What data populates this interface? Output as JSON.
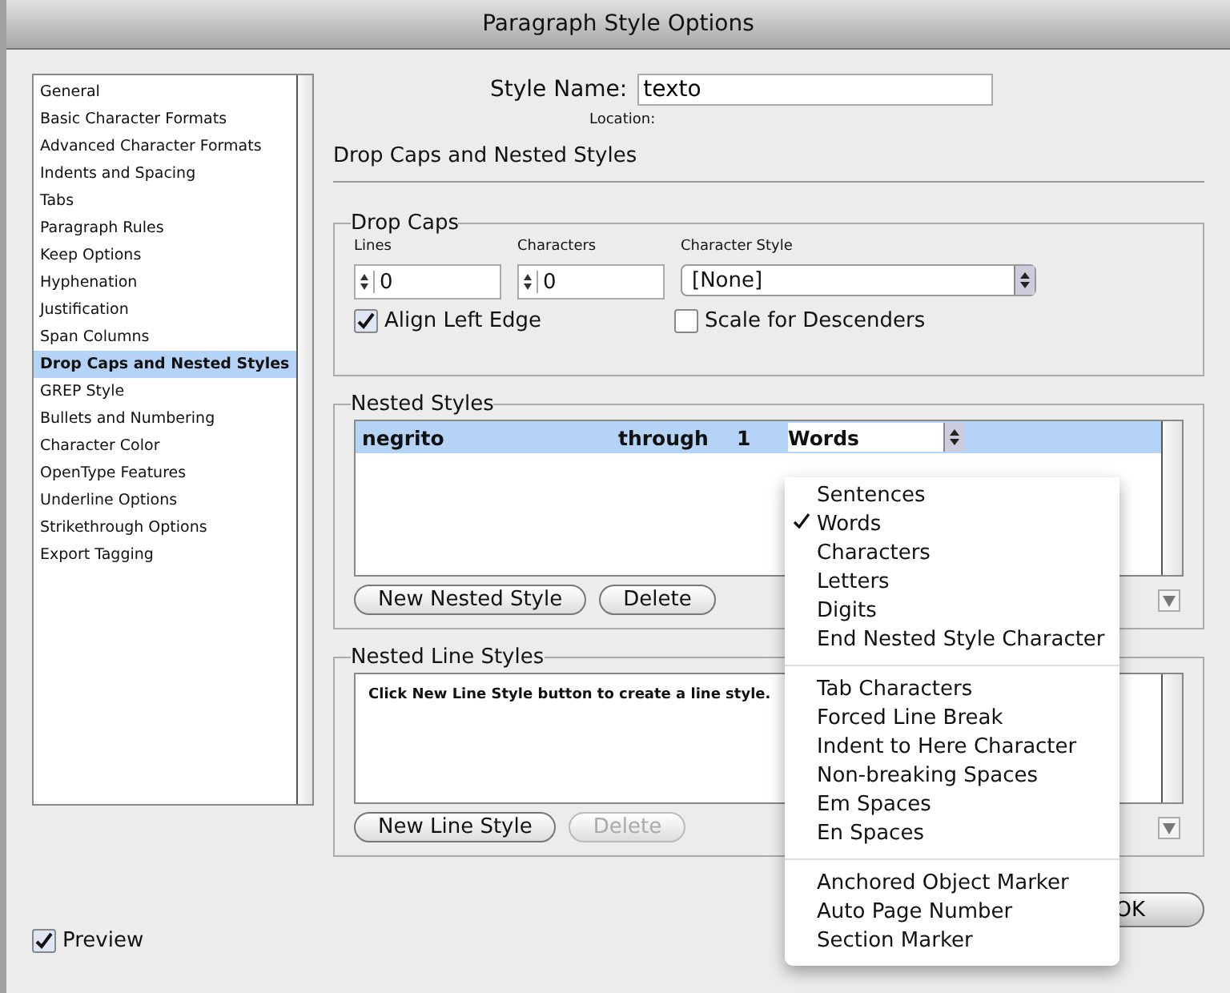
{
  "window": {
    "title": "Paragraph Style Options"
  },
  "sidebar": {
    "items": [
      {
        "label": "General",
        "selected": false
      },
      {
        "label": "Basic Character Formats",
        "selected": false
      },
      {
        "label": "Advanced Character Formats",
        "selected": false
      },
      {
        "label": "Indents and Spacing",
        "selected": false
      },
      {
        "label": "Tabs",
        "selected": false
      },
      {
        "label": "Paragraph Rules",
        "selected": false
      },
      {
        "label": "Keep Options",
        "selected": false
      },
      {
        "label": "Hyphenation",
        "selected": false
      },
      {
        "label": "Justification",
        "selected": false
      },
      {
        "label": "Span Columns",
        "selected": false
      },
      {
        "label": "Drop Caps and Nested Styles",
        "selected": true
      },
      {
        "label": "GREP Style",
        "selected": false
      },
      {
        "label": "Bullets and Numbering",
        "selected": false
      },
      {
        "label": "Character Color",
        "selected": false
      },
      {
        "label": "OpenType Features",
        "selected": false
      },
      {
        "label": "Underline Options",
        "selected": false
      },
      {
        "label": "Strikethrough Options",
        "selected": false
      },
      {
        "label": "Export Tagging",
        "selected": false
      }
    ]
  },
  "style_name": {
    "label": "Style Name:",
    "value": "texto"
  },
  "location": {
    "label": "Location:"
  },
  "section_title": "Drop Caps and Nested Styles",
  "drop_caps": {
    "title": "Drop Caps",
    "lines": {
      "label": "Lines",
      "value": "0"
    },
    "characters": {
      "label": "Characters",
      "value": "0"
    },
    "character_style": {
      "label": "Character Style",
      "value": "[None]"
    },
    "align_left_edge": {
      "label": "Align Left Edge",
      "checked": true
    },
    "scale_for_descenders": {
      "label": "Scale for Descenders",
      "checked": false
    }
  },
  "nested_styles": {
    "title": "Nested Styles",
    "rows": [
      {
        "style": "negrito",
        "mode": "through",
        "count": "1",
        "unit": "Words",
        "selected": true
      }
    ],
    "buttons": [
      {
        "label": "New Nested Style",
        "disabled": false
      },
      {
        "label": "Delete",
        "disabled": false
      }
    ]
  },
  "unit_menu": {
    "groups": [
      [
        {
          "label": "Sentences",
          "checked": false
        },
        {
          "label": "Words",
          "checked": true
        },
        {
          "label": "Characters",
          "checked": false
        },
        {
          "label": "Letters",
          "checked": false
        },
        {
          "label": "Digits",
          "checked": false
        },
        {
          "label": "End Nested Style Character",
          "checked": false
        }
      ],
      [
        {
          "label": "Tab Characters",
          "checked": false
        },
        {
          "label": "Forced Line Break",
          "checked": false
        },
        {
          "label": "Indent to Here Character",
          "checked": false
        },
        {
          "label": "Non-breaking Spaces",
          "checked": false
        },
        {
          "label": "Em Spaces",
          "checked": false
        },
        {
          "label": "En Spaces",
          "checked": false
        }
      ],
      [
        {
          "label": "Anchored Object Marker",
          "checked": false
        },
        {
          "label": "Auto Page Number",
          "checked": false
        },
        {
          "label": "Section Marker",
          "checked": false
        }
      ]
    ]
  },
  "nested_line_styles": {
    "title": "Nested Line Styles",
    "hint": "Click New Line Style button to create a line style.",
    "buttons": [
      {
        "label": "New Line Style",
        "disabled": false
      },
      {
        "label": "Delete",
        "disabled": true
      }
    ]
  },
  "preview": {
    "label": "Preview",
    "checked": true
  },
  "ok_button": {
    "label": "OK"
  }
}
